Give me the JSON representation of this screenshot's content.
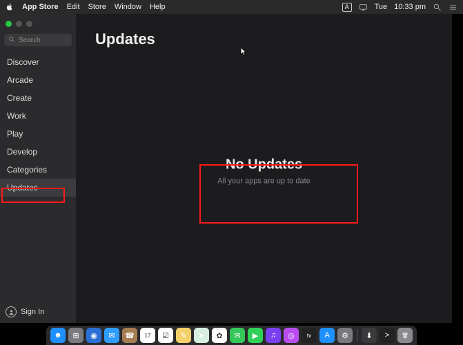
{
  "menubar": {
    "app_name": "App Store",
    "menus": [
      "Edit",
      "Store",
      "Window",
      "Help"
    ],
    "status": {
      "day": "Tue",
      "time": "10:33 pm",
      "input_indicator": "A"
    }
  },
  "sidebar": {
    "search_placeholder": "Search",
    "items": [
      {
        "label": "Discover",
        "selected": false
      },
      {
        "label": "Arcade",
        "selected": false
      },
      {
        "label": "Create",
        "selected": false
      },
      {
        "label": "Work",
        "selected": false
      },
      {
        "label": "Play",
        "selected": false
      },
      {
        "label": "Develop",
        "selected": false
      },
      {
        "label": "Categories",
        "selected": false
      },
      {
        "label": "Updates",
        "selected": true
      }
    ],
    "signin_label": "Sign In"
  },
  "content": {
    "page_title": "Updates",
    "empty_title": "No Updates",
    "empty_subtitle": "All your apps are up to date"
  },
  "dock": {
    "items": [
      {
        "name": "finder",
        "color": "#1e90ff",
        "glyph": "☻"
      },
      {
        "name": "launchpad",
        "color": "#7a7a7e",
        "glyph": "⊞"
      },
      {
        "name": "safari",
        "color": "#2a6fd6",
        "glyph": "◉"
      },
      {
        "name": "mail",
        "color": "#2f9cff",
        "glyph": "✉"
      },
      {
        "name": "contacts",
        "color": "#a67c52",
        "glyph": "☎"
      },
      {
        "name": "calendar",
        "color": "#ffffff",
        "glyph": "17"
      },
      {
        "name": "reminders",
        "color": "#ffffff",
        "glyph": "☑"
      },
      {
        "name": "notes",
        "color": "#f4d06a",
        "glyph": "✎"
      },
      {
        "name": "maps",
        "color": "#d7efe1",
        "glyph": "➤"
      },
      {
        "name": "photos",
        "color": "#ffffff",
        "glyph": "✿"
      },
      {
        "name": "messages",
        "color": "#34c759",
        "glyph": "✉"
      },
      {
        "name": "facetime",
        "color": "#30d158",
        "glyph": "▶"
      },
      {
        "name": "music",
        "color": "#7b3ff2",
        "glyph": "♫"
      },
      {
        "name": "podcasts",
        "color": "#b84df0",
        "glyph": "◎"
      },
      {
        "name": "tv",
        "color": "#222222",
        "glyph": "tv"
      },
      {
        "name": "appstore",
        "color": "#1e90ff",
        "glyph": "A"
      },
      {
        "name": "settings",
        "color": "#7a7a7e",
        "glyph": "⚙"
      }
    ],
    "right": [
      {
        "name": "downloads",
        "color": "#3a3a3c",
        "glyph": "⬇"
      },
      {
        "name": "terminal",
        "color": "#222222",
        "glyph": ">"
      },
      {
        "name": "trash",
        "color": "#8a8a8e",
        "glyph": "🗑"
      }
    ]
  }
}
